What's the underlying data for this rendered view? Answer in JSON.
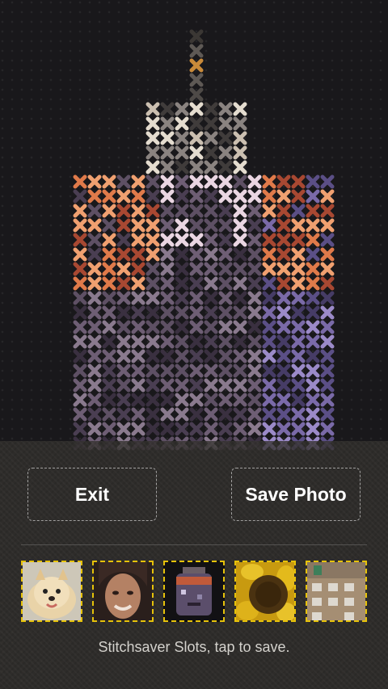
{
  "buttons": {
    "exit_label": "Exit",
    "save_label": "Save Photo"
  },
  "slots": {
    "hint": "Stitchsaver Slots, tap to save.",
    "items": [
      {
        "label": "dog-thumbnail"
      },
      {
        "label": "face-thumbnail"
      },
      {
        "label": "stitch-thumbnail"
      },
      {
        "label": "sunflower-thumbnail"
      },
      {
        "label": "building-thumbnail"
      }
    ]
  },
  "colors": {
    "slot_border": "#e6c20a",
    "panel_bg": "#34322e",
    "text": "#ffffff"
  }
}
